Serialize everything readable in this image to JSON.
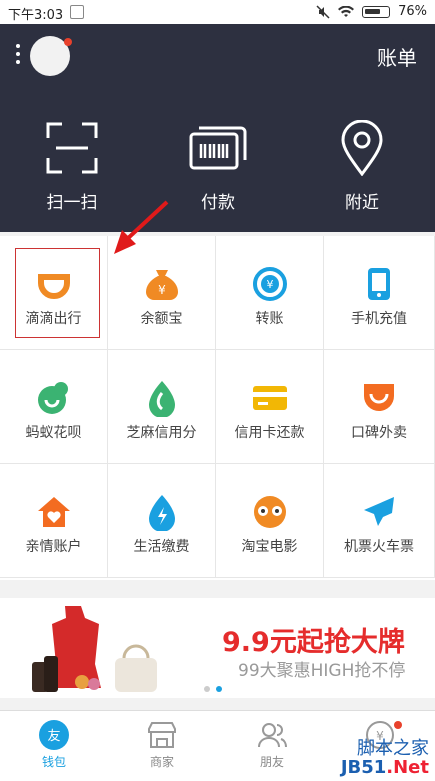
{
  "status_bar": {
    "time": "下午3:03",
    "battery": "76%",
    "battery_level": 0.76
  },
  "header": {
    "bill_label": "账单",
    "quick_actions": [
      {
        "label": "扫一扫",
        "icon": "scan-icon"
      },
      {
        "label": "付款",
        "icon": "barcode-pay-icon"
      },
      {
        "label": "附近",
        "icon": "location-pin-icon"
      }
    ]
  },
  "grid": {
    "items": [
      {
        "label": "滴滴出行",
        "icon": "didi-icon",
        "color": "#f08a24"
      },
      {
        "label": "余额宝",
        "icon": "money-bag-icon",
        "color": "#f08a24"
      },
      {
        "label": "转账",
        "icon": "transfer-icon",
        "color": "#1aa0e0"
      },
      {
        "label": "手机充值",
        "icon": "phone-recharge-icon",
        "color": "#1aa0e0"
      },
      {
        "label": "蚂蚁花呗",
        "icon": "huabei-icon",
        "color": "#3bb372"
      },
      {
        "label": "芝麻信用分",
        "icon": "sesame-credit-icon",
        "color": "#3bb372"
      },
      {
        "label": "信用卡还款",
        "icon": "credit-card-icon",
        "color": "#f2b705"
      },
      {
        "label": "口碑外卖",
        "icon": "koubei-takeout-icon",
        "color": "#f36c21"
      },
      {
        "label": "亲情账户",
        "icon": "family-account-icon",
        "color": "#f36c21"
      },
      {
        "label": "生活缴费",
        "icon": "utility-payment-icon",
        "color": "#1aa0e0"
      },
      {
        "label": "淘宝电影",
        "icon": "taobao-movie-icon",
        "color": "#f08a24"
      },
      {
        "label": "机票火车票",
        "icon": "plane-ticket-icon",
        "color": "#1aa0e0"
      }
    ]
  },
  "banner": {
    "title": "9.9元起抢大牌",
    "subtitle": "99大聚惠HIGH抢不停"
  },
  "tabbar": {
    "tabs": [
      {
        "label": "钱包",
        "icon": "wallet-icon",
        "active": true
      },
      {
        "label": "商家",
        "icon": "shop-icon",
        "active": false
      },
      {
        "label": "朋友",
        "icon": "friends-icon",
        "active": false
      },
      {
        "label": "我的",
        "icon": "me-icon",
        "active": false
      }
    ]
  },
  "watermark": {
    "line1": "脚本之家",
    "line2a": "JB51",
    "line2b": ".Net"
  },
  "colors": {
    "header_bg": "#2d3040",
    "accent": "#1aa0e0",
    "highlight_red": "#cc3333"
  }
}
